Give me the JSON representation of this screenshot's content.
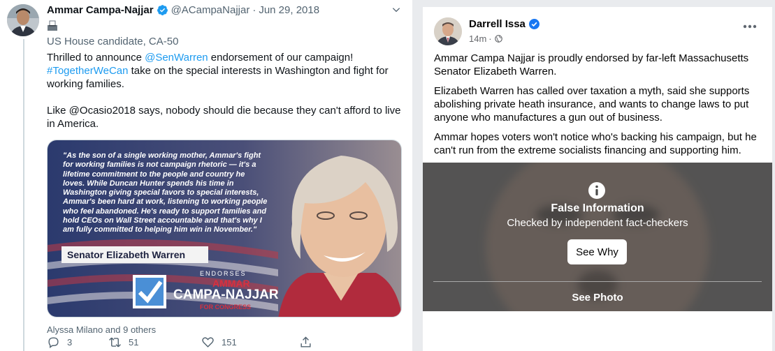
{
  "tweet": {
    "name": "Ammar Campa-Najjar",
    "handle": "@ACampaNajjar",
    "separator": "·",
    "date": "Jun 29, 2018",
    "bio": "US House candidate, CA-50",
    "text": {
      "p1_a": "Thrilled to announce ",
      "p1_mention": "@SenWarren",
      "p1_b": " endorsement of our campaign!",
      "p1_hashtag": "#TogetherWeCan",
      "p1_c": " take on the special interests in Washington and fight for working families.",
      "p2": "Like @Ocasio2018 says, nobody should die because they can't afford to live in America."
    },
    "image": {
      "quote_lines": [
        "\"As the son of a single working mother, Ammar's fight",
        "for working families is not campaign rhetoric — it's a",
        "lifetime commitment to the people and country he",
        "loves. While Duncan Hunter spends his time in",
        "Washington giving special favors to special interests,",
        "Ammar's been hard at work, listening to working people",
        "who feel abandoned. He's ready to support families and",
        "hold CEOs on Wall Street accountable and that's why I",
        "am fully committed to helping him win in November.\""
      ],
      "attribution": "Senator Elizabeth Warren",
      "endorses": "ENDORSES",
      "logo_first": "AMMAR",
      "logo_last": "CAMPA-NAJJAR",
      "logo_sub": "FOR CONGRESS"
    },
    "liked_by": "Alyssa Milano and 9 others",
    "actions": {
      "replies": "3",
      "retweets": "51",
      "likes": "151"
    },
    "colors": {
      "link": "#1d9bf0",
      "secondary": "#536471"
    }
  },
  "facebook": {
    "name": "Darrell Issa",
    "time": "14m",
    "meta_separator": "·",
    "paragraphs": [
      "Ammar Campa Najjar is proudly endorsed by far-left Massachusetts Senator Elizabeth Warren.",
      "Elizabeth Warren has called over taxation a myth, said she supports abolishing private heath insurance, and wants to change laws to put anyone who manufactures a gun out of business.",
      "Ammar hopes voters won't notice who's backing his campaign, but he can't run from the extreme socialists financing and supporting him."
    ],
    "overlay": {
      "title": "False Information",
      "subtitle": "Checked by independent fact-checkers",
      "button": "See Why",
      "see_photo": "See Photo"
    },
    "colors": {
      "verified": "#1877f2",
      "secondary": "#65676b"
    }
  }
}
